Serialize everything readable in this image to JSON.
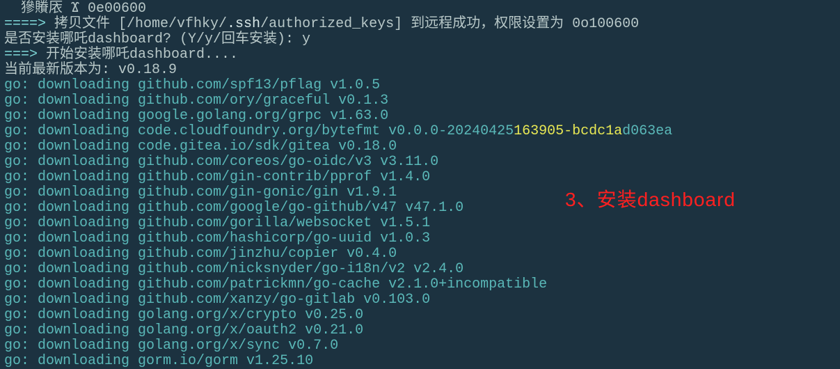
{
  "lines": [
    {
      "segments": [
        {
          "text": "  ",
          "color": "gray"
        },
        {
          "text": "㺑䞉㕈 Ϫ 0e00600",
          "color": "gray"
        }
      ]
    },
    {
      "segments": [
        {
          "text": "====> ",
          "color": "cyan-bright"
        },
        {
          "text": "拷贝文件 [/home/vfhky/",
          "color": "gray"
        },
        {
          "text": ".ssh",
          "color": "white"
        },
        {
          "text": "/authorized_keys] 到远程成功，权限设置为 0o100600",
          "color": "gray"
        }
      ]
    },
    {
      "segments": [
        {
          "text": "是否安装哪吒dashboard? (Y/y/回车安装): y",
          "color": "gray"
        }
      ]
    },
    {
      "segments": [
        {
          "text": "===> ",
          "color": "cyan-bright"
        },
        {
          "text": "开始安装哪吒dashboard....",
          "color": "gray"
        }
      ]
    },
    {
      "segments": [
        {
          "text": "当前最新版本为: v0.18.9",
          "color": "gray"
        }
      ]
    },
    {
      "segments": [
        {
          "text": "go: downloading github.com/spf13/pflag v1.0.5",
          "color": "cyan"
        }
      ]
    },
    {
      "segments": [
        {
          "text": "go: downloading github.com/ory/graceful v0.1.3",
          "color": "cyan"
        }
      ]
    },
    {
      "segments": [
        {
          "text": "go: downloading google.golang.org/grpc v1.63.0",
          "color": "cyan"
        }
      ]
    },
    {
      "segments": [
        {
          "text": "go: downloading code.cloudfoundry.org/bytefmt v0.0.0-20240425",
          "color": "cyan"
        },
        {
          "text": "163905-bcdc1a",
          "color": "yellow"
        },
        {
          "text": "d063ea",
          "color": "cyan"
        }
      ]
    },
    {
      "segments": [
        {
          "text": "go: downloading code.gitea.io/sdk/gitea v0.18.0",
          "color": "cyan"
        }
      ]
    },
    {
      "segments": [
        {
          "text": "go: downloading github.com/coreos/go-oidc/v3 v3.11.0",
          "color": "cyan"
        }
      ]
    },
    {
      "segments": [
        {
          "text": "go: downloading github.com/gin-contrib/pprof v1.4.0",
          "color": "cyan"
        }
      ]
    },
    {
      "segments": [
        {
          "text": "go: downloading github.com/gin-gonic/gin v1.9.1",
          "color": "cyan"
        }
      ]
    },
    {
      "segments": [
        {
          "text": "go: downloading github.com/google/go-github/v47 v47.1.0",
          "color": "cyan"
        }
      ]
    },
    {
      "segments": [
        {
          "text": "go: downloading github.com/gorilla/websocket v1.5.1",
          "color": "cyan"
        }
      ]
    },
    {
      "segments": [
        {
          "text": "go: downloading github.com/hashicorp/go-uuid v1.0.3",
          "color": "cyan"
        }
      ]
    },
    {
      "segments": [
        {
          "text": "go: downloading github.com/jinzhu/copier v0.4.0",
          "color": "cyan"
        }
      ]
    },
    {
      "segments": [
        {
          "text": "go: downloading github.com/nicksnyder/go-i18n/v2 v2.4.0",
          "color": "cyan"
        }
      ]
    },
    {
      "segments": [
        {
          "text": "go: downloading github.com/patrickmn/go-cache v2.1.0+incompatible",
          "color": "cyan"
        }
      ]
    },
    {
      "segments": [
        {
          "text": "go: downloading github.com/xanzy/go-gitlab v0.103.0",
          "color": "cyan"
        }
      ]
    },
    {
      "segments": [
        {
          "text": "go: downloading golang.org/x/crypto v0.25.0",
          "color": "cyan"
        }
      ]
    },
    {
      "segments": [
        {
          "text": "go: downloading golang.org/x/oauth2 v0.21.0",
          "color": "cyan"
        }
      ]
    },
    {
      "segments": [
        {
          "text": "go: downloading golang.org/x/sync v0.7.0",
          "color": "cyan"
        }
      ]
    },
    {
      "segments": [
        {
          "text": "go: downloading gorm.io/gorm v1.25.10",
          "color": "cyan"
        }
      ]
    }
  ],
  "annotation": "3、安装dashboard"
}
